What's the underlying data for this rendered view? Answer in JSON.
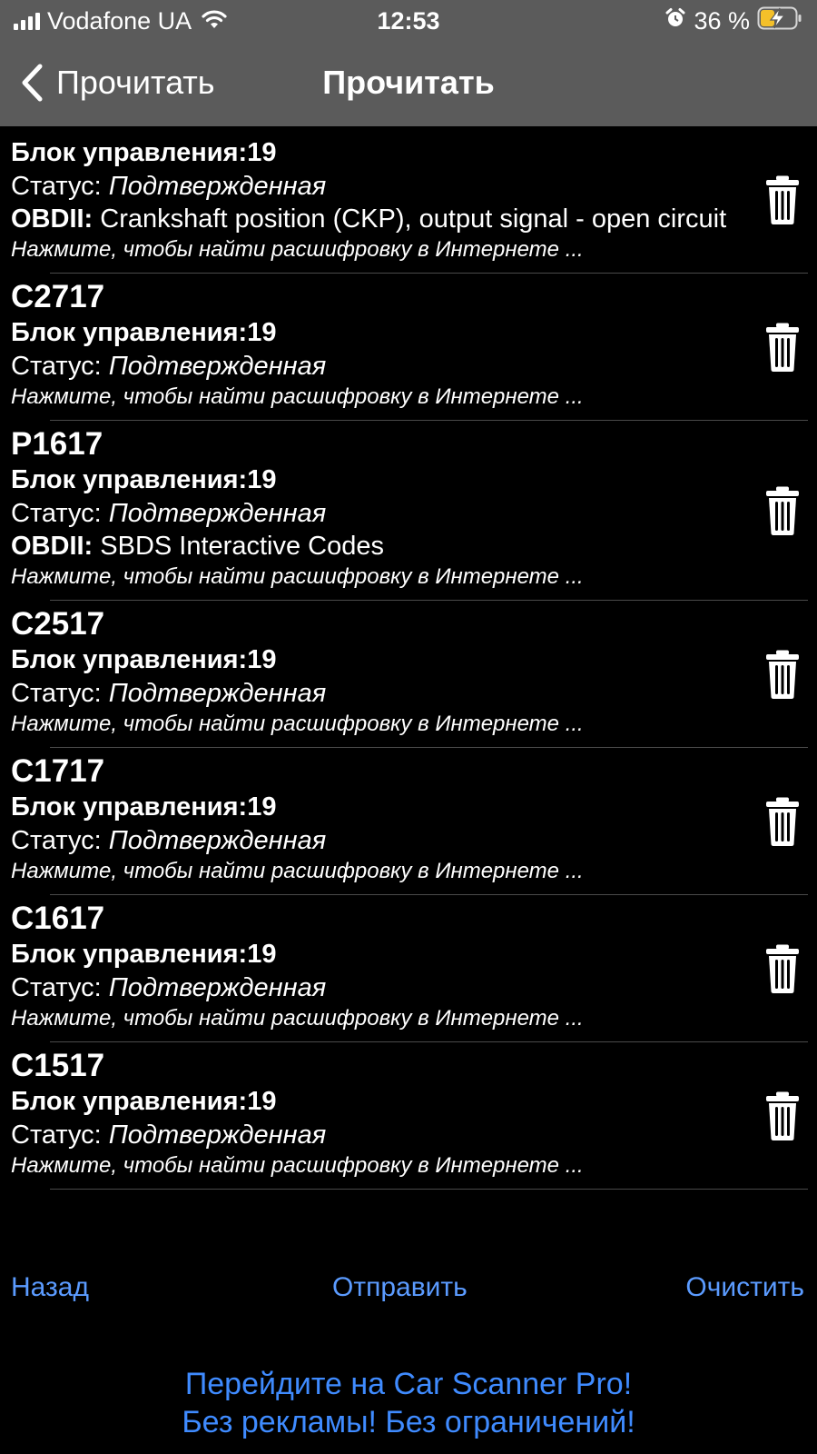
{
  "status_bar": {
    "carrier": "Vodafone UA",
    "time": "12:53",
    "battery": "36 %",
    "icons": [
      "signal-icon",
      "wifi-icon",
      "alarm-icon",
      "battery-charging-icon"
    ]
  },
  "nav": {
    "back_label": "Прочитать",
    "title": "Прочитать"
  },
  "colors": {
    "bar_background": "#5b5b5b",
    "link": "#5b9bff",
    "promo": "#3f8bff",
    "battery_fill": "#f4c02a"
  },
  "labels": {
    "block_prefix": "Блок управления:",
    "status_prefix": "Статус: ",
    "obd_prefix": "OBDII:",
    "hint": "Нажмите, чтобы найти расшифровку в Интернете ..."
  },
  "dtc_items": [
    {
      "code": "",
      "block": "19",
      "status": "Подтвержденная",
      "obd": "Crankshaft position (CKP), output signal - open circuit",
      "partial": true
    },
    {
      "code": "C2717",
      "block": "19",
      "status": "Подтвержденная",
      "obd": ""
    },
    {
      "code": "P1617",
      "block": "19",
      "status": "Подтвержденная",
      "obd": "SBDS Interactive Codes"
    },
    {
      "code": "C2517",
      "block": "19",
      "status": "Подтвержденная",
      "obd": ""
    },
    {
      "code": "C1717",
      "block": "19",
      "status": "Подтвержденная",
      "obd": ""
    },
    {
      "code": "C1617",
      "block": "19",
      "status": "Подтвержденная",
      "obd": ""
    },
    {
      "code": "C1517",
      "block": "19",
      "status": "Подтвержденная",
      "obd": ""
    }
  ],
  "toolbar": {
    "back": "Назад",
    "send": "Отправить",
    "clear": "Очистить"
  },
  "promo": {
    "line1": "Перейдите на Car Scanner Pro!",
    "line2": "Без рекламы! Без ограничений!"
  }
}
